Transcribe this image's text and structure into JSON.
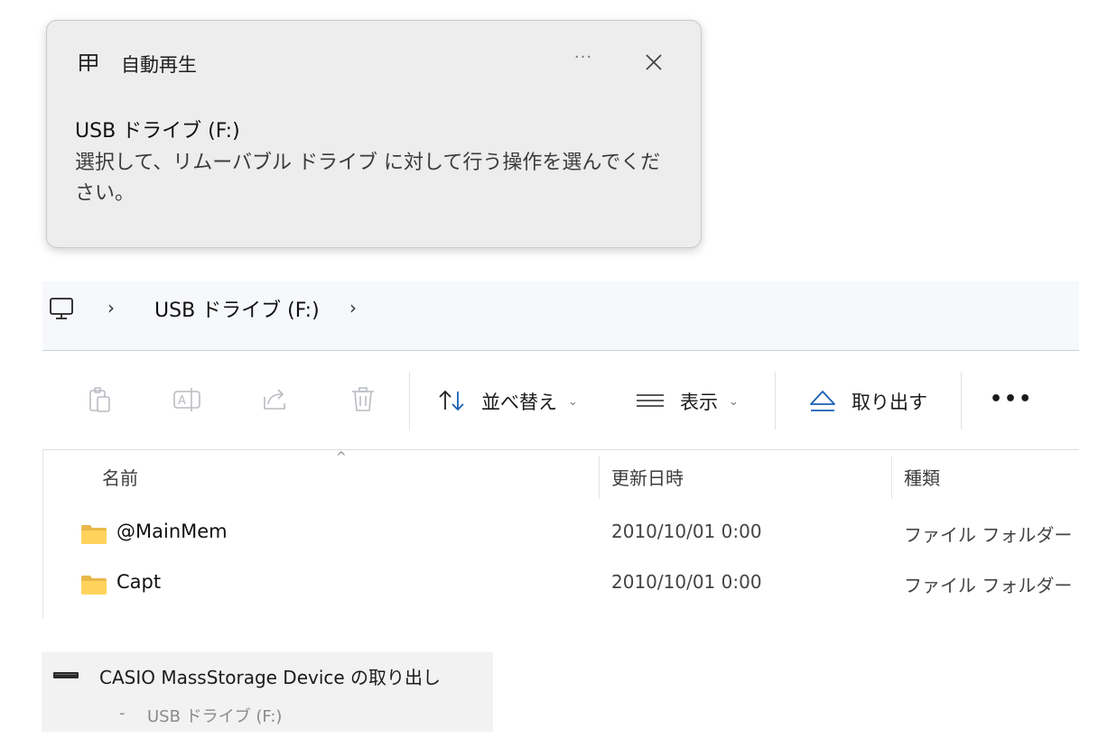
{
  "toast": {
    "app_icon": "autoplay-icon",
    "app_name": "自動再生",
    "more": "···",
    "close_icon": "close-icon",
    "title": "USB ドライブ (F:)",
    "body_line1": "選択して、リムーバブル ドライブ に対して行う操作を選んでくだ",
    "body_line2": "さい。"
  },
  "addressbar": {
    "root_icon": "this-pc-icon",
    "separator1": "›",
    "drive": "USB ドライブ (F:)",
    "separator2": "›"
  },
  "toolbar": {
    "icons": [
      "paste-icon",
      "rename-icon",
      "share-icon",
      "delete-icon"
    ],
    "sort_label": "並べ替え",
    "view_label": "表示",
    "eject_label": "取り出す",
    "chevron": "⌄",
    "more": "•••"
  },
  "filelist": {
    "sort_caret": "^",
    "columns": {
      "name": "名前",
      "modified": "更新日時",
      "type": "種類"
    },
    "rows": [
      {
        "name": "@MainMem",
        "modified": "2010/10/01 0:00",
        "type": "ファイル フォルダー"
      },
      {
        "name": "Capt",
        "modified": "2010/10/01 0:00",
        "type": "ファイル フォルダー"
      }
    ]
  },
  "eject_item": {
    "icon": "drive-icon",
    "title": "CASIO MassStorage Device の取り出し",
    "dash": "-",
    "subtitle": "USB ドライブ (F:)"
  }
}
